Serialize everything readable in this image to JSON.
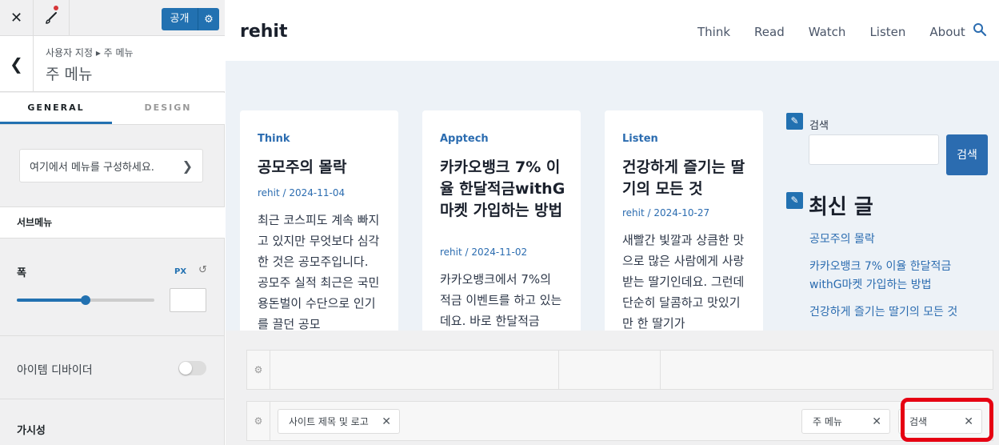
{
  "topbar": {
    "close_icon": "close-icon",
    "brush_icon": "paintbrush-icon",
    "publish_label": "공개",
    "publish_gear_icon": "gear-icon",
    "notify_color": "#d63638"
  },
  "crumb": {
    "path": "사용자 지정 ▸ 주 메뉴",
    "title": "주 메뉴"
  },
  "tabs": [
    {
      "label": "GENERAL",
      "active": true
    },
    {
      "label": "DESIGN",
      "active": false
    }
  ],
  "menu_link": {
    "label": "여기에서 메뉴를 구성하세요.",
    "icon": "chevron-right-icon"
  },
  "submenu": {
    "heading": "서브메뉴"
  },
  "width": {
    "label": "폭",
    "unit": "PX",
    "reset_icon": "reset-icon",
    "slider_percent": 50,
    "value": ""
  },
  "divider": {
    "label": "아이템 디바이더",
    "enabled": false
  },
  "visibility": {
    "label": "가시성"
  },
  "site": {
    "title": "rehit",
    "nav": [
      "Think",
      "Read",
      "Watch",
      "Listen",
      "About"
    ],
    "search_icon": "search-icon"
  },
  "posts": [
    {
      "category": "Think",
      "title": "공모주의 몰락",
      "meta": "rehit / 2024-11-04",
      "excerpt": "최근 코스피도 계속 빠지고 있지만 무엇보다 심각한 것은 공모주입니다. 공모주 실적 최근은 국민 용돈벌이 수단으로 인기를 끌던 공모"
    },
    {
      "category": "Apptech",
      "title": "카카오뱅크 7% 이율 한달적금withG마켓 가입하는 방법",
      "meta": "rehit / 2024-11-02",
      "excerpt": "카카오뱅크에서 7%의 적금 이벤트를 하고 있는데요. 바로 한달적금"
    },
    {
      "category": "Listen",
      "title": "건강하게 즐기는 딸기의 모든 것",
      "meta": "rehit / 2024-10-27",
      "excerpt": "새빨간 빛깔과 상큼한 맛으로 많은 사람에게 사랑받는 딸기인데요. 그런데 단순히 달콤하고 맛있기만 한 딸기가"
    }
  ],
  "sidebar": {
    "search_label": "검색",
    "search_button": "검색",
    "recent_title": "최신 글",
    "recent_posts": [
      "공모주의 몰락",
      "카카오뱅크 7% 이율 한달적금 withG마켓 가입하는 방법",
      "건강하게 즐기는 딸기의 모든 것"
    ],
    "edit_icon": "pencil-icon"
  },
  "builder": {
    "gear_icon": "gear-icon",
    "row2_items": [
      {
        "label": "사이트 제목 및 로고"
      },
      {
        "label": "주 메뉴"
      },
      {
        "label": "검색"
      }
    ],
    "remove_icon": "close-icon",
    "highlight_color": "#e60012"
  }
}
